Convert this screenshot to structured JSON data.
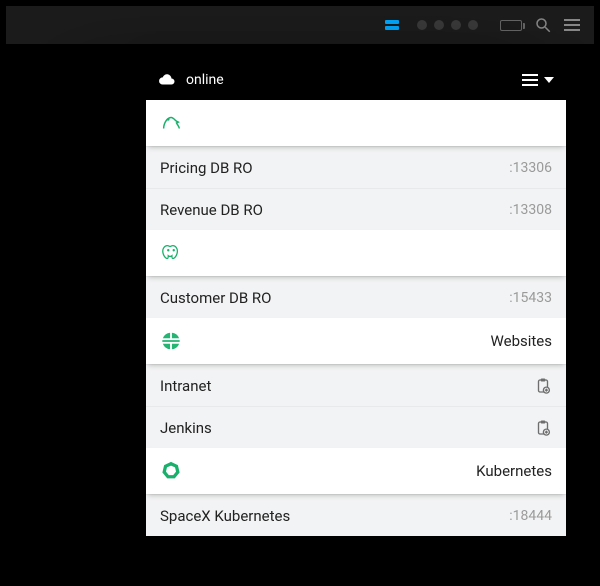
{
  "header": {
    "status": "online"
  },
  "sections": [
    {
      "icon": "mysql-icon",
      "label": ""
    },
    {
      "icon": "postgres-icon",
      "label": ""
    },
    {
      "icon": "globe-icon",
      "label": "Websites"
    },
    {
      "icon": "kubernetes-icon",
      "label": "Kubernetes"
    }
  ],
  "rows": {
    "s0": [
      {
        "name": "Pricing DB RO",
        "port": ":13306"
      },
      {
        "name": "Revenue DB RO",
        "port": ":13308"
      }
    ],
    "s1": [
      {
        "name": "Customer DB RO",
        "port": ":15433"
      }
    ],
    "s2": [
      {
        "name": "Intranet"
      },
      {
        "name": "Jenkins"
      }
    ],
    "s3": [
      {
        "name": "SpaceX Kubernetes",
        "port": ":18444"
      }
    ]
  }
}
